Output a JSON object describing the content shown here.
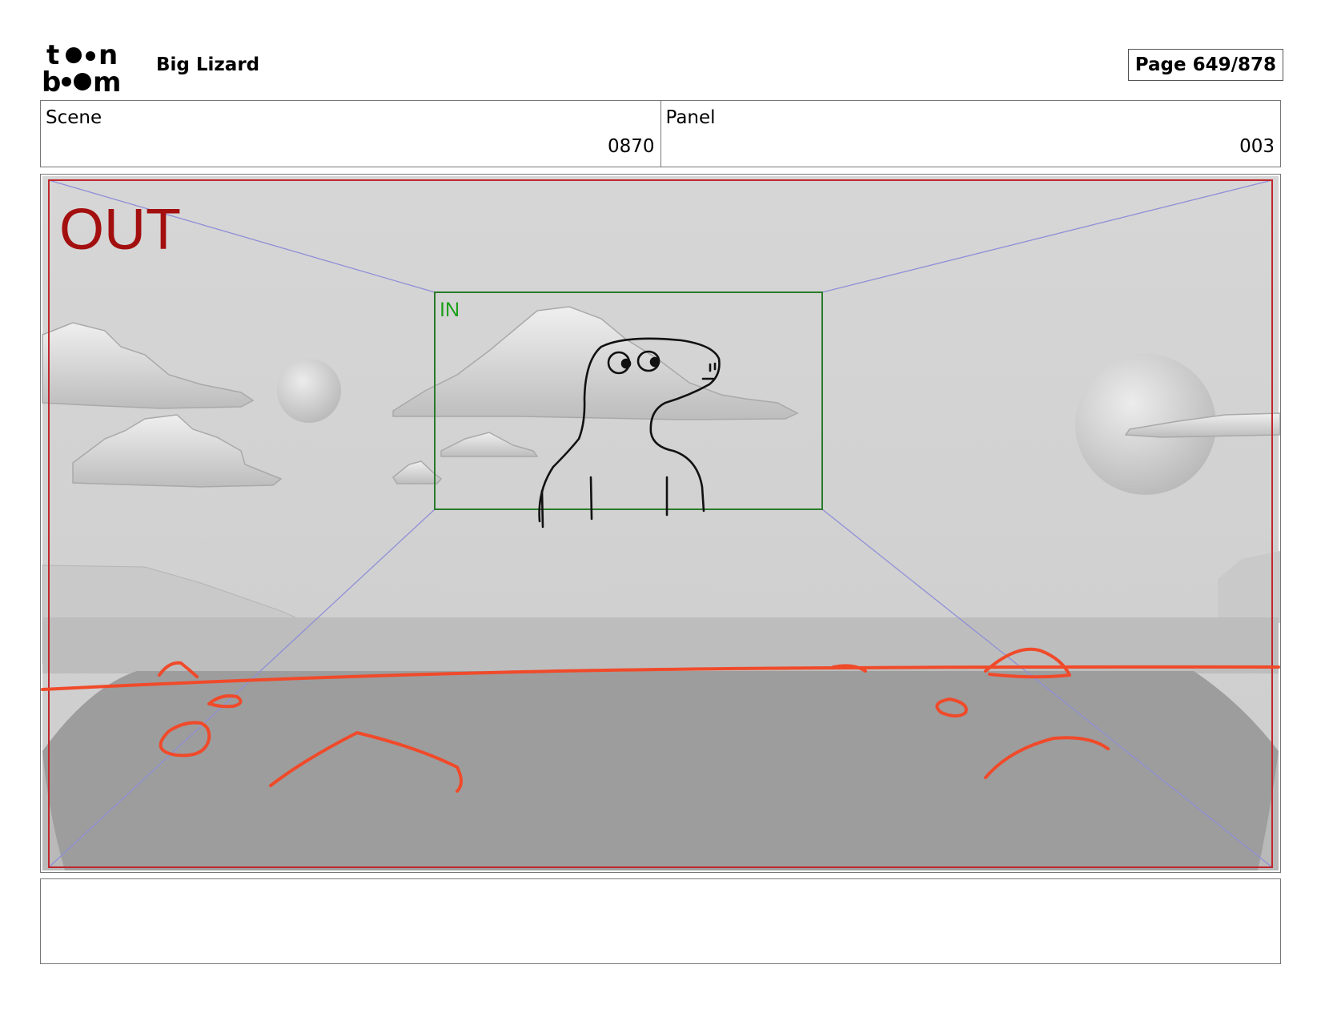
{
  "header": {
    "logo_line1": "toon",
    "logo_line2": "boom",
    "project_title": "Big Lizard",
    "page_label": "Page 649/878"
  },
  "info": {
    "scene_label": "Scene",
    "scene_value": "0870",
    "panel_label": "Panel",
    "panel_value": "003"
  },
  "panel": {
    "out_label": "OUT",
    "in_label": "IN",
    "colors": {
      "out_frame": "#c0272d",
      "out_text": "#a30f0f",
      "in_frame": "#2a7a2a",
      "in_text": "#1aa01a",
      "guides": "#8f8fd8",
      "sketch_red": "#f04a2a",
      "sketch_black": "#111111",
      "sky": "#d3d3d3",
      "ground": "#9d9d9d"
    }
  },
  "caption": {
    "text": ""
  }
}
